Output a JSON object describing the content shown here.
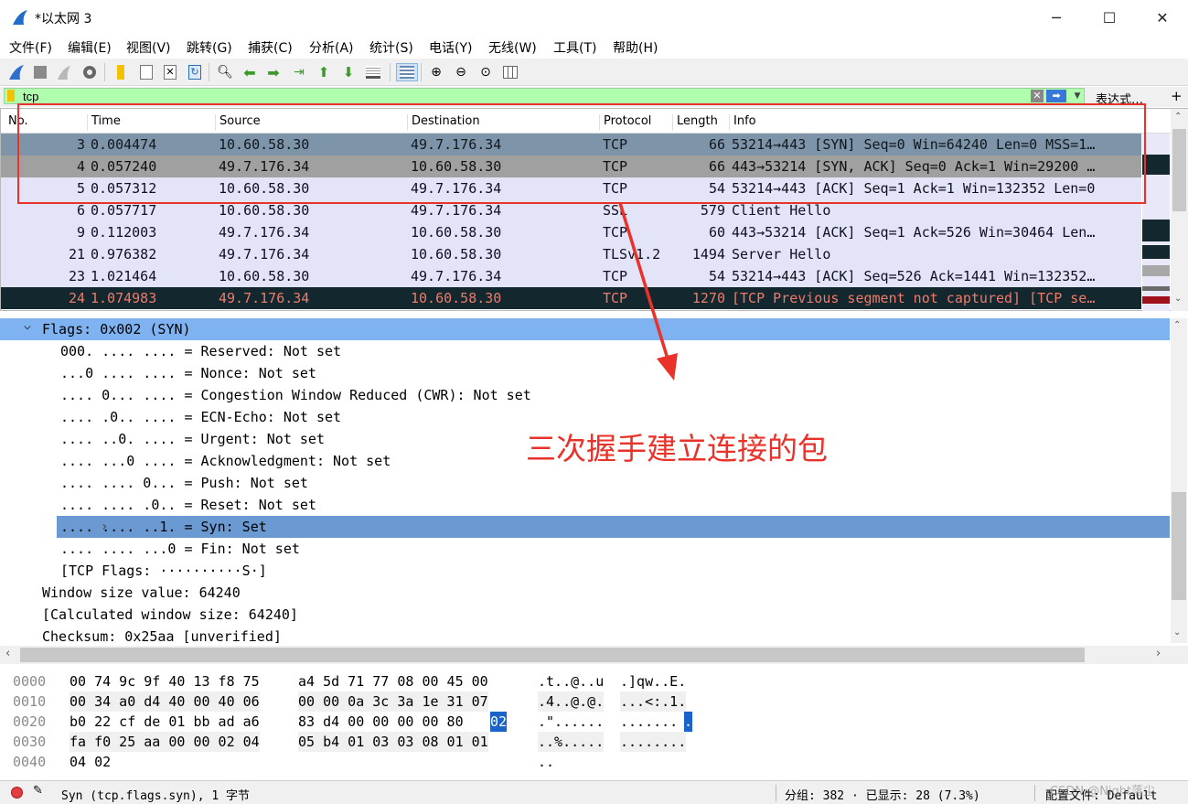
{
  "window": {
    "title": "*以太网 3",
    "minimize_glyph": "─",
    "maximize_glyph": "☐",
    "close_glyph": "✕"
  },
  "menu": [
    "文件(F)",
    "编辑(E)",
    "视图(V)",
    "跳转(G)",
    "捕获(C)",
    "分析(A)",
    "统计(S)",
    "电话(Y)",
    "无线(W)",
    "工具(T)",
    "帮助(H)"
  ],
  "toolbar_icons": [
    "shark-fin-start-icon",
    "stop-capture-icon",
    "restart-capture-icon",
    "capture-options-icon",
    "open-file-icon",
    "save-file-icon",
    "close-file-icon",
    "reload-file-icon",
    "find-packet-icon",
    "go-back-icon",
    "go-forward-icon",
    "go-to-packet-icon",
    "go-first-icon",
    "go-last-icon",
    "autoscroll-icon",
    "colorize-icon",
    "zoom-in-icon",
    "zoom-out-icon",
    "zoom-normal-icon",
    "resize-columns-icon"
  ],
  "filter": {
    "value": "tcp",
    "clear_glyph": "✕",
    "apply_glyph": "➡",
    "history_glyph": "▼",
    "expression_label": "表达式…",
    "plus_glyph": "+"
  },
  "packet_list": {
    "columns": [
      "No.",
      "Time",
      "Source",
      "Destination",
      "Protocol",
      "Length",
      "Info"
    ],
    "rows": [
      {
        "no": "3",
        "time": "0.004474",
        "src": "10.60.58.30",
        "dst": "49.7.176.34",
        "proto": "TCP",
        "len": "66",
        "info": "53214→443 [SYN] Seq=0 Win=64240 Len=0 MSS=1…"
      },
      {
        "no": "4",
        "time": "0.057240",
        "src": "49.7.176.34",
        "dst": "10.60.58.30",
        "proto": "TCP",
        "len": "66",
        "info": "443→53214 [SYN, ACK] Seq=0 Ack=1 Win=29200 …"
      },
      {
        "no": "5",
        "time": "0.057312",
        "src": "10.60.58.30",
        "dst": "49.7.176.34",
        "proto": "TCP",
        "len": "54",
        "info": "53214→443 [ACK] Seq=1 Ack=1 Win=132352 Len=0"
      },
      {
        "no": "6",
        "time": "0.057717",
        "src": "10.60.58.30",
        "dst": "49.7.176.34",
        "proto": "SSL",
        "len": "579",
        "info": "Client Hello"
      },
      {
        "no": "9",
        "time": "0.112003",
        "src": "49.7.176.34",
        "dst": "10.60.58.30",
        "proto": "TCP",
        "len": "60",
        "info": "443→53214 [ACK] Seq=1 Ack=526 Win=30464 Len…"
      },
      {
        "no": "21",
        "time": "0.976382",
        "src": "49.7.176.34",
        "dst": "10.60.58.30",
        "proto": "TLSv1.2",
        "len": "1494",
        "info": "Server Hello"
      },
      {
        "no": "23",
        "time": "1.021464",
        "src": "10.60.58.30",
        "dst": "49.7.176.34",
        "proto": "TCP",
        "len": "54",
        "info": "53214→443 [ACK] Seq=526 Ack=1441 Win=132352…"
      },
      {
        "no": "24",
        "time": "1.074983",
        "src": "49.7.176.34",
        "dst": "10.60.58.30",
        "proto": "TCP",
        "len": "1270",
        "info": "[TCP Previous segment not captured] [TCP se…"
      }
    ]
  },
  "details": {
    "lines": [
      "Flags: 0x002 (SYN)",
      "000. .... .... = Reserved: Not set",
      "...0 .... .... = Nonce: Not set",
      ".... 0... .... = Congestion Window Reduced (CWR): Not set",
      ".... .0.. .... = ECN-Echo: Not set",
      ".... ..0. .... = Urgent: Not set",
      ".... ...0 .... = Acknowledgment: Not set",
      ".... .... 0... = Push: Not set",
      ".... .... .0.. = Reset: Not set",
      ".... .... ..1. = Syn: Set",
      ".... .... ...0 = Fin: Not set",
      "[TCP Flags: ··········S·]",
      "Window size value: 64240",
      "[Calculated window size: 64240]",
      "Checksum: 0x25aa [unverified]"
    ],
    "expanded_glyph": "⌵",
    "collapsed_glyph": "›"
  },
  "bytes": {
    "rows": [
      {
        "offset": "0000",
        "hex1": "00 74 9c 9f 40 13 f8 75",
        "hex2": "a4 5d 71 77 08 00 45 00",
        "ascii1": ".t..@..u",
        "ascii2": ".]qw..E."
      },
      {
        "offset": "0010",
        "hex1": "00 34 a0 d4 40 00 40 06",
        "hex2": "00 00 0a 3c 3a 1e 31 07",
        "ascii1": ".4..@.@.",
        "ascii2": "...<:.1."
      },
      {
        "offset": "0020",
        "hex1": "b0 22 cf de 01 bb ad a6",
        "hex2": "83 d4 00 00 00 00 80",
        "hex_sel": "02",
        "ascii1": ".\"......",
        "ascii2": ".......",
        "ascii_sel": "."
      },
      {
        "offset": "0030",
        "hex1": "fa f0 25 aa 00 00 02 04",
        "hex2": "05 b4 01 03 03 08 01 01",
        "ascii1": "..%.....",
        "ascii2": "........"
      },
      {
        "offset": "0040",
        "hex1": "04 02",
        "hex2": "",
        "ascii1": "..",
        "ascii2": ""
      }
    ]
  },
  "status": {
    "field_text": "Syn (tcp.flags.syn), 1 字节",
    "packets_text": "分组: 382 · 已显示: 28 (7.3%)",
    "profile_text": "配置文件: Default",
    "watermark": "CSDN @Night落尘"
  },
  "annotation": {
    "text": "三次握手建立连接的包",
    "color": "#e8322a"
  }
}
